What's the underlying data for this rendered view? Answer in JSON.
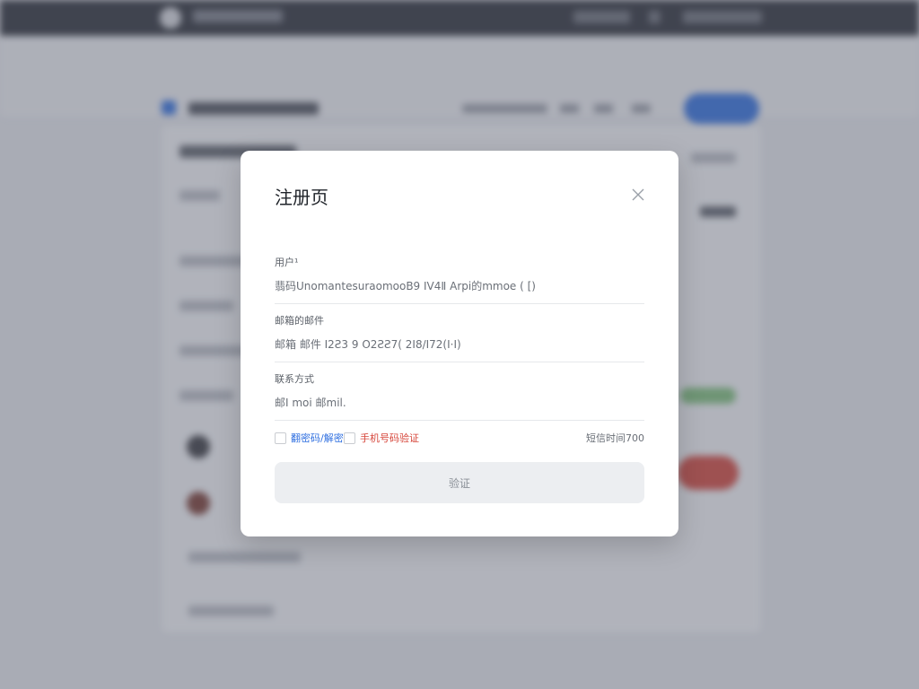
{
  "dialog": {
    "title": "注册页",
    "fields": [
      {
        "label": "用户¹",
        "value": "翡码UnomantesuraomooB9 ⅠⅤ4Ⅱ   Arpi的mmoe ( [)"
      },
      {
        "label": "邮箱的邮件",
        "value": "邮箱    邮件        I2Ƨ3 9 O2ƧƧ7(   2I8/I72(Ⅰ·Ⅰ)"
      },
      {
        "label": "联系方式",
        "value": "邮I    moi    邮mil."
      }
    ],
    "options": {
      "checkbox_blue_label": "翻密码/解密",
      "checkbox_red_label": "手机号码验证",
      "timer_text": "短信时间700"
    },
    "submit_label": "验证"
  },
  "colors": {
    "accent_blue": "#2f6fe0",
    "accent_red": "#d6453a",
    "topbar": "#2b2e36"
  }
}
